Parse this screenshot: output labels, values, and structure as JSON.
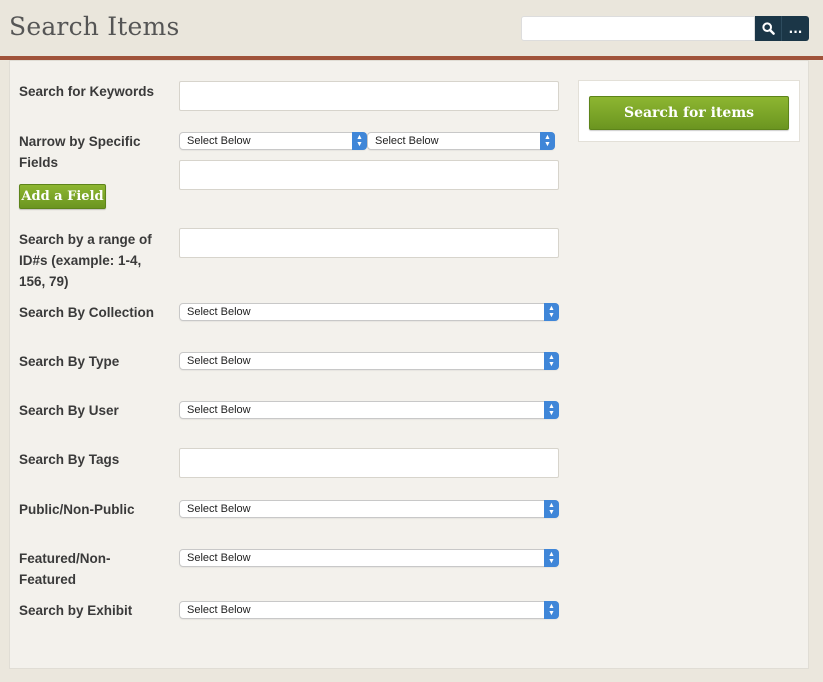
{
  "header": {
    "title": "Search Items",
    "search_placeholder": "",
    "search_icon": "search-icon",
    "advanced_label": "..."
  },
  "form": {
    "keywords_label": "Search for Keywords",
    "narrow_label": "Narrow by Specific Fields",
    "narrow_field_select": "Select Below",
    "narrow_type_select": "Select Below",
    "add_field_label": "Add a Field",
    "range_label": "Search by a range of ID#s (example: 1-4, 156, 79)",
    "collection_label": "Search By Collection",
    "collection_select": "Select Below",
    "type_label": "Search By Type",
    "type_select": "Select Below",
    "user_label": "Search By User",
    "user_select": "Select Below",
    "tags_label": "Search By Tags",
    "public_label": "Public/Non-Public",
    "public_select": "Select Below",
    "featured_label": "Featured/Non-Featured",
    "featured_select": "Select Below",
    "exhibit_label": "Search by Exhibit",
    "exhibit_select": "Select Below"
  },
  "sidebar": {
    "submit_label": "Search for items"
  },
  "colors": {
    "header_rule": "#a0533a",
    "button_green": "#7ba52a",
    "search_button": "#1b3647",
    "select_arrow": "#3f86d8"
  }
}
